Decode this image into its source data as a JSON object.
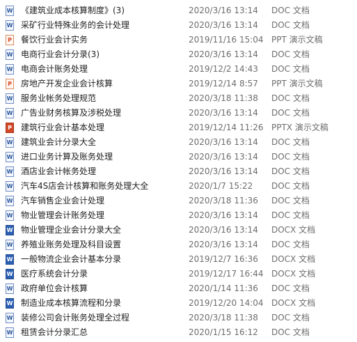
{
  "files": [
    {
      "name": "《建筑业成本核算制度》(3)",
      "date": "2020/3/16 13:14",
      "type": "DOC 文档",
      "icon": "doc-icon",
      "badge": "W"
    },
    {
      "name": "采矿行业特殊业务的会计处理",
      "date": "2020/3/16 13:14",
      "type": "DOC 文档",
      "icon": "doc-icon",
      "badge": "W"
    },
    {
      "name": "餐饮行业会计实务",
      "date": "2019/11/16 15:04",
      "type": "PPT 演示文稿",
      "icon": "ppt-icon",
      "badge": "P"
    },
    {
      "name": "电商行业会计分录(3)",
      "date": "2020/3/16 13:14",
      "type": "DOC 文档",
      "icon": "doc-icon",
      "badge": "W"
    },
    {
      "name": "电商会计账务处理",
      "date": "2019/12/2 14:43",
      "type": "DOC 文档",
      "icon": "doc-icon",
      "badge": "W"
    },
    {
      "name": "房地产开发企业会计核算",
      "date": "2019/12/14 8:57",
      "type": "PPT 演示文稿",
      "icon": "ppt-icon",
      "badge": "P"
    },
    {
      "name": "服务业帐务处理规范",
      "date": "2020/3/18 11:38",
      "type": "DOC 文档",
      "icon": "doc-icon",
      "badge": "W"
    },
    {
      "name": "广告业财务核算及涉税处理",
      "date": "2020/3/16 13:14",
      "type": "DOC 文档",
      "icon": "doc-icon",
      "badge": "W"
    },
    {
      "name": "建筑行业会计基本处理",
      "date": "2019/12/14 11:26",
      "type": "PPTX 演示文稿",
      "icon": "pptx-icon",
      "badge": "P"
    },
    {
      "name": "建筑业会计分录大全",
      "date": "2020/3/16 13:14",
      "type": "DOC 文档",
      "icon": "doc-icon",
      "badge": "W"
    },
    {
      "name": "进口业务计算及账务处理",
      "date": "2020/3/16 13:14",
      "type": "DOC 文档",
      "icon": "doc-icon",
      "badge": "W"
    },
    {
      "name": "酒店业会计帐务处理",
      "date": "2020/3/16 13:14",
      "type": "DOC 文档",
      "icon": "doc-icon",
      "badge": "W"
    },
    {
      "name": "汽车4S店会计核算和账务处理大全",
      "date": "2020/1/7 15:22",
      "type": "DOC 文档",
      "icon": "doc-icon",
      "badge": "W"
    },
    {
      "name": "汽车销售企业会计处理",
      "date": "2020/3/18 11:36",
      "type": "DOC 文档",
      "icon": "doc-icon",
      "badge": "W"
    },
    {
      "name": "物业管理会计账务处理",
      "date": "2020/3/16 13:14",
      "type": "DOC 文档",
      "icon": "doc-icon",
      "badge": "W"
    },
    {
      "name": "物业管理企业会计分录大全",
      "date": "2020/3/16 13:14",
      "type": "DOCX 文档",
      "icon": "docx-icon",
      "badge": "W"
    },
    {
      "name": "养殖业账务处理及科目设置",
      "date": "2020/3/16 13:14",
      "type": "DOC 文档",
      "icon": "doc-icon",
      "badge": "W"
    },
    {
      "name": "一般物流企业会计基本分录",
      "date": "2019/12/7 16:36",
      "type": "DOCX 文档",
      "icon": "docx-icon",
      "badge": "W"
    },
    {
      "name": "医疗系统会计分录",
      "date": "2019/12/17 16:44",
      "type": "DOCX 文档",
      "icon": "docx-icon",
      "badge": "W"
    },
    {
      "name": "政府单位会计核算",
      "date": "2020/1/14 11:36",
      "type": "DOC 文档",
      "icon": "doc-icon",
      "badge": "W"
    },
    {
      "name": "制造业成本核算流程和分录",
      "date": "2019/12/20 14:04",
      "type": "DOCX 文档",
      "icon": "docx-icon",
      "badge": "W"
    },
    {
      "name": "装修公司会计账务处理全过程",
      "date": "2020/3/18 11:38",
      "type": "DOC 文档",
      "icon": "doc-icon",
      "badge": "W"
    },
    {
      "name": "租赁会计分录汇总",
      "date": "2020/1/15 16:12",
      "type": "DOC 文档",
      "icon": "doc-icon",
      "badge": "W"
    }
  ]
}
